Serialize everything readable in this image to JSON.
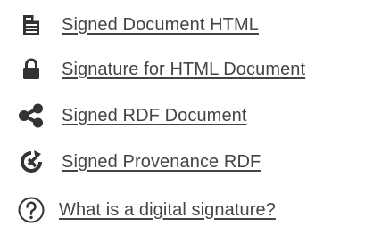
{
  "links": [
    {
      "label": "Signed Document HTML",
      "icon": "document-icon"
    },
    {
      "label": "Signature for HTML Document",
      "icon": "lock-icon"
    },
    {
      "label": "Signed RDF Document",
      "icon": "share-nodes-icon"
    },
    {
      "label": "Signed Provenance RDF",
      "icon": "provenance-cycle-icon"
    },
    {
      "label": "What is a digital signature?",
      "icon": "question-circle-icon"
    }
  ],
  "colors": {
    "icon": "#333333",
    "link_text": "#444444",
    "background": "#ffffff"
  }
}
